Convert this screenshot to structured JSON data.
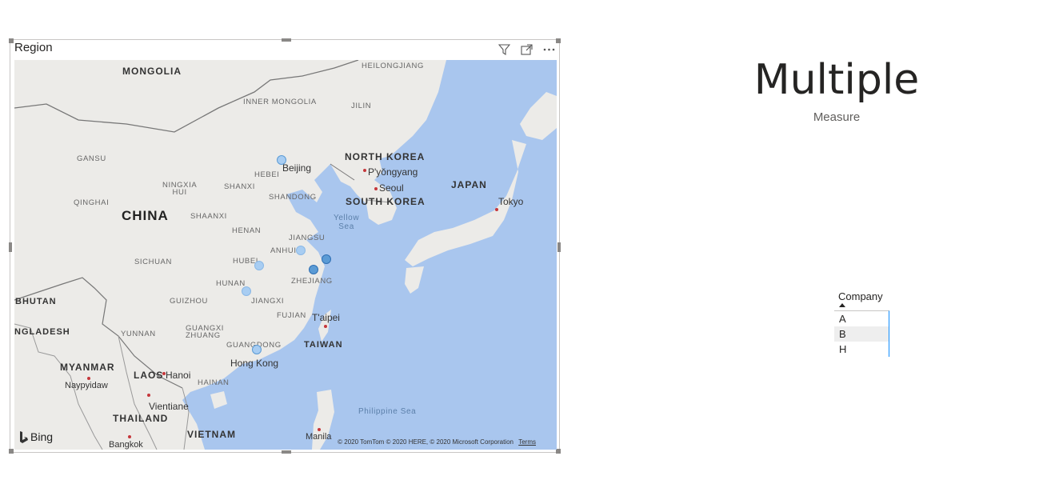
{
  "map_visual": {
    "title": "Region",
    "header_icons": [
      "filter-icon",
      "focus-mode-icon",
      "more-options-icon"
    ],
    "countries": {
      "mongolia": "MONGOLIA",
      "china": "CHINA",
      "north_korea": "NORTH KOREA",
      "south_korea": "SOUTH KOREA",
      "japan": "JAPAN",
      "taiwan": "TAIWAN",
      "myanmar": "MYANMAR",
      "laos": "LAOS",
      "thailand": "THAILAND",
      "vietnam": "VIETNAM",
      "bhutan": "BHUTAN",
      "bangladesh": "NGLADESH"
    },
    "provinces": {
      "heilongjiang": "HEILONGJIANG",
      "inner_mongolia": "INNER MONGOLIA",
      "jilin": "JILIN",
      "gansu": "GANSU",
      "hebei": "HEBEI",
      "ningxia": "NINGXIA\nHUI",
      "shanxi": "SHANXI",
      "shandong": "SHANDONG",
      "qinghai": "QINGHAI",
      "shaanxi": "SHAANXI",
      "henan": "HENAN",
      "jiangsu": "JIANGSU",
      "anhui": "ANHUI",
      "sichuan": "SICHUAN",
      "hubei": "HUBEI",
      "zhejiang": "ZHEJIANG",
      "hunan": "HUNAN",
      "guizhou": "GUIZHOU",
      "jiangxi": "JIANGXI",
      "fujian": "FUJIAN",
      "yunnan": "YUNNAN",
      "guangxi": "GUANGXI\nZHUANG",
      "guangdong": "GUANGDONG",
      "hainan": "HAINAN"
    },
    "cities": {
      "beijing": "Beijing",
      "pyongyang": "P'yŏngyang",
      "seoul": "Seoul",
      "tokyo": "Tokyo",
      "taipei": "T'aipei",
      "hong_kong": "Hong Kong",
      "hanoi": "Hanoi",
      "naypyidaw": "Naypyidaw",
      "vientiane": "Vientiane",
      "bangkok": "Bangkok",
      "manila": "Manila"
    },
    "seas": {
      "yellow_sea": "Yellow\nSea",
      "philippine_sea": "Philippine Sea"
    },
    "bing_label": "Bing",
    "copyright": "© 2020 TomTom © 2020 HERE, © 2020 Microsoft Corporation",
    "terms": "Terms",
    "bubble_colors": {
      "light": "#a8cdf2",
      "dark": "#5b9bd5"
    }
  },
  "card": {
    "value": "Multiple",
    "label": "Measure"
  },
  "table": {
    "header": "Company",
    "sort": "ascending",
    "rows": [
      "A",
      "B",
      "H"
    ],
    "highlighted_row": "B"
  }
}
